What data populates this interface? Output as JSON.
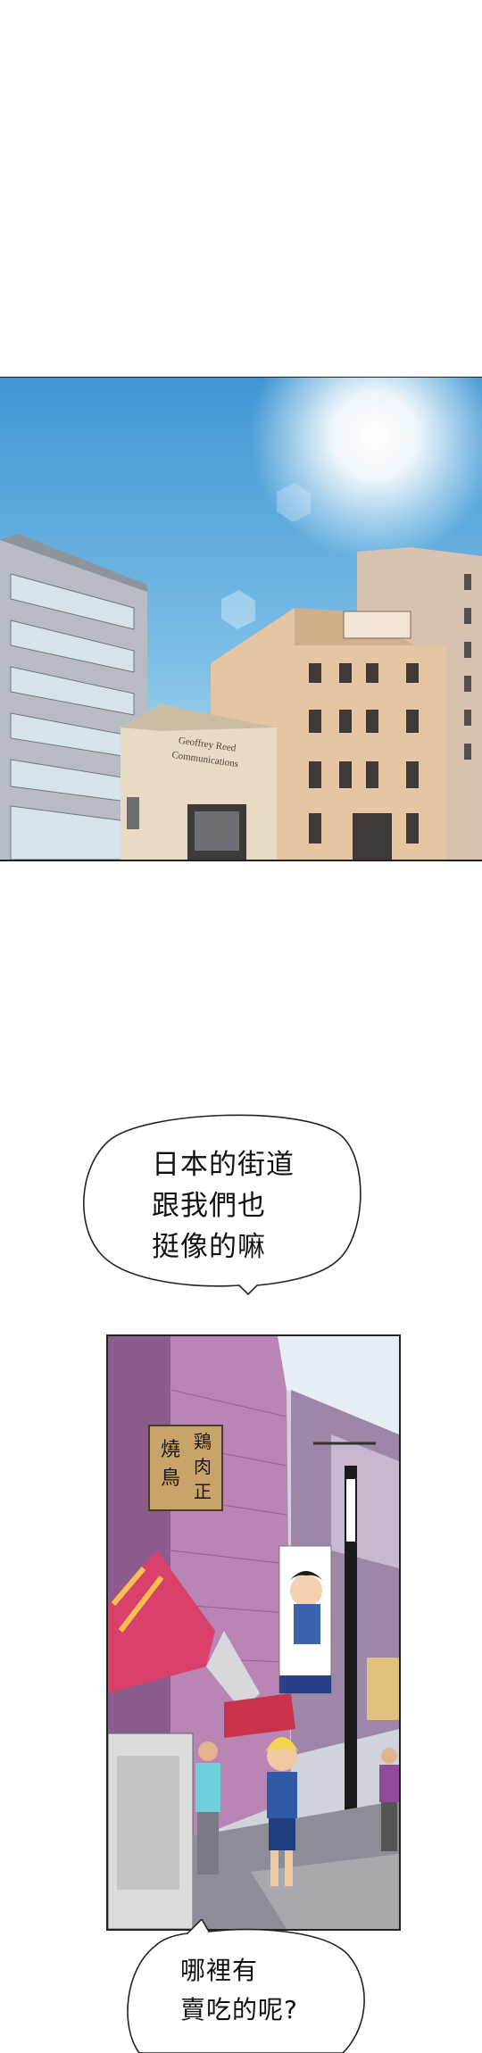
{
  "panels": [
    {
      "scene": "sky-buildings",
      "building_sign": [
        "Geoffrey Reed",
        "Communications"
      ]
    },
    {
      "scene": "street",
      "shop_sign": {
        "left": [
          "燒",
          "鳥"
        ],
        "right": [
          "鶏",
          "肉",
          "正"
        ]
      }
    }
  ],
  "bubbles": [
    {
      "text": "日本的街道\n跟我們也\n挺像的嘛"
    },
    {
      "text": "哪裡有\n賣吃的呢?"
    }
  ],
  "colors": {
    "sky_top": "#4a9fd8",
    "sky_bottom": "#b9dcef",
    "building_beige": "#e8c9a8",
    "street_purple": "#b07ab0",
    "shirt_blue": "#2e5aa8",
    "hair_yellow": "#f2d54a"
  }
}
